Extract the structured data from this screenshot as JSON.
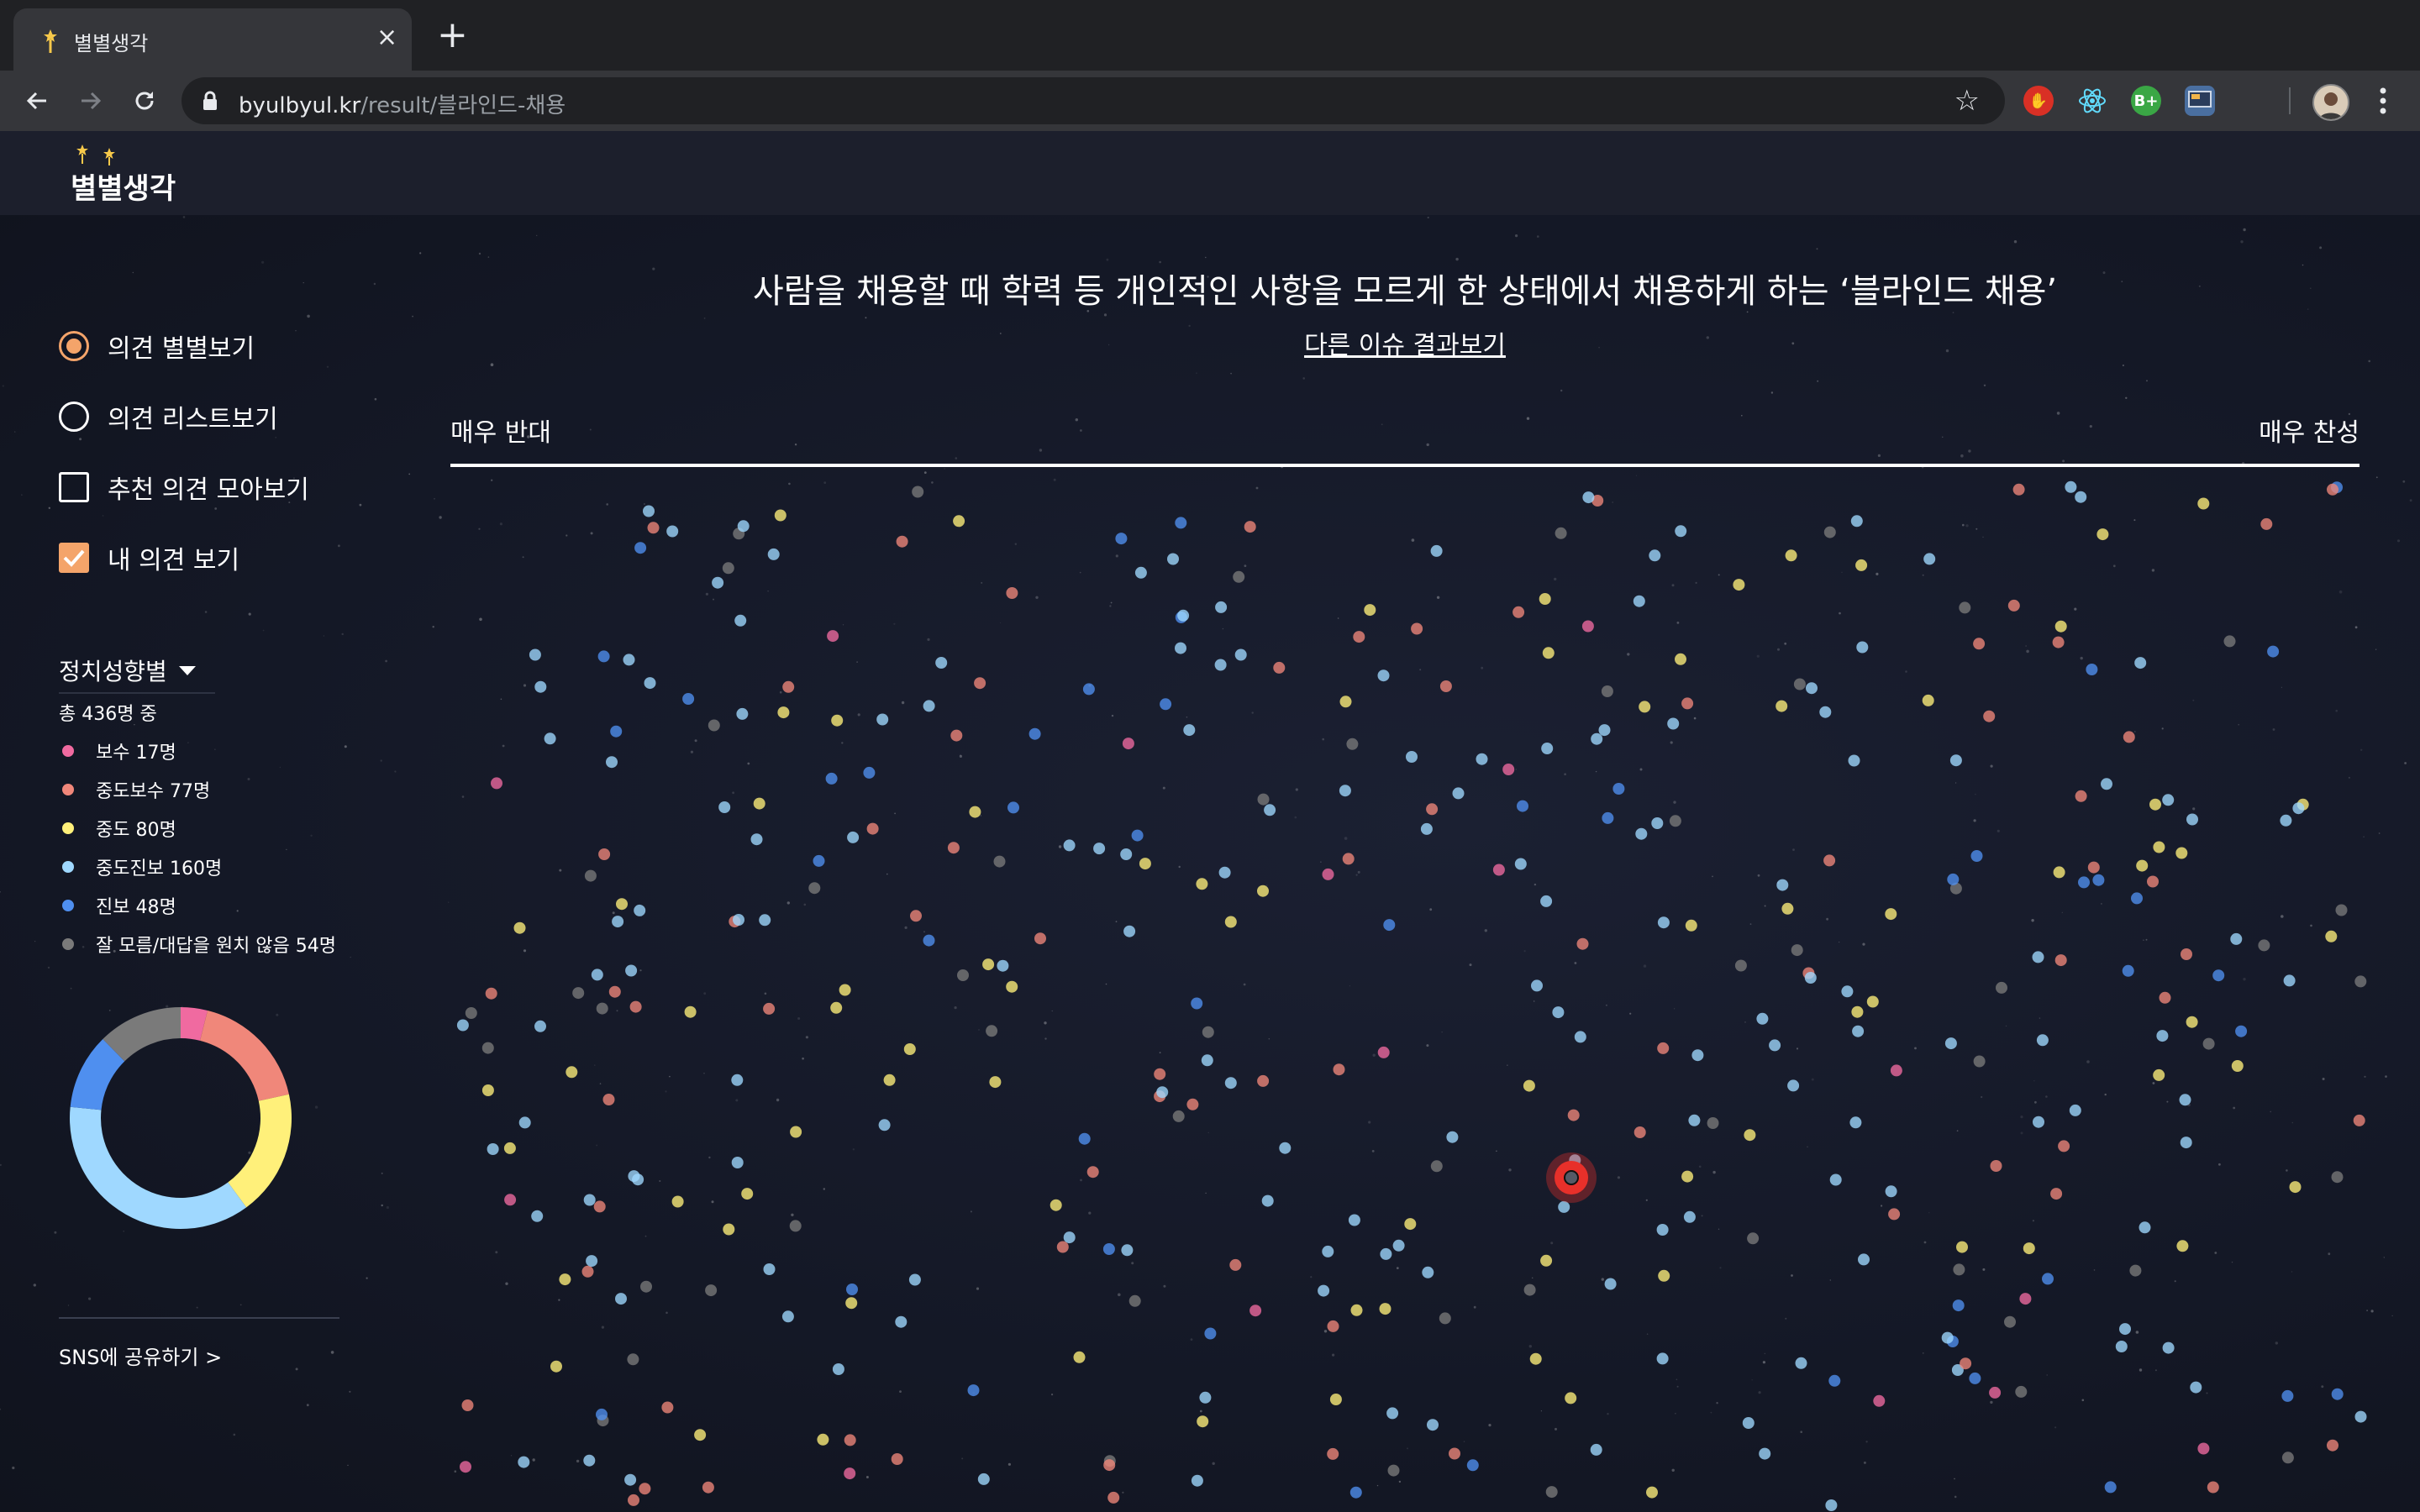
{
  "browser": {
    "tab_title": "별별생각",
    "url_host": "byulbyul.kr",
    "url_path": "/result/블라인드-채용",
    "extensions": [
      "adblock-icon",
      "react-icon",
      "b-plus-icon",
      "screen-icon"
    ],
    "ext_b_plus_label": "B+"
  },
  "site": {
    "logo_text": "별별생각"
  },
  "sidebar": {
    "options": [
      {
        "label": "의견 별별보기",
        "type": "radio",
        "checked": true
      },
      {
        "label": "의견 리스트보기",
        "type": "radio",
        "checked": false
      },
      {
        "label": "추천 의견 모아보기",
        "type": "checkbox",
        "checked": false
      },
      {
        "label": "내 의견 보기",
        "type": "checkbox",
        "checked": true
      }
    ],
    "filter_label": "정치성향별",
    "total_label": "총 436명 중",
    "legend": [
      {
        "label": "보수 17명",
        "color": "#f06aa0",
        "count": 17
      },
      {
        "label": "중도보수 77명",
        "color": "#f0877a",
        "count": 77
      },
      {
        "label": "중도 80명",
        "color": "#fff07a",
        "count": 80
      },
      {
        "label": "중도진보 160명",
        "color": "#9fd8ff",
        "count": 160
      },
      {
        "label": "진보 48명",
        "color": "#4f8fef",
        "count": 48
      },
      {
        "label": "잘 모름/대답을 원치 않음 54명",
        "color": "#7a7a7a",
        "count": 54
      }
    ],
    "share_label": "SNS에 공유하기 >"
  },
  "main": {
    "question": "사람을 채용할 때 학력 등 개인적인 사항을 모르게 한 상태에서 채용하게 하는 ‘블라인드 채용’",
    "other_link": "다른 이슈 결과보기",
    "scale_left": "매우 반대",
    "scale_right": "매우 찬성",
    "highlight_color": "#e8302a"
  }
}
